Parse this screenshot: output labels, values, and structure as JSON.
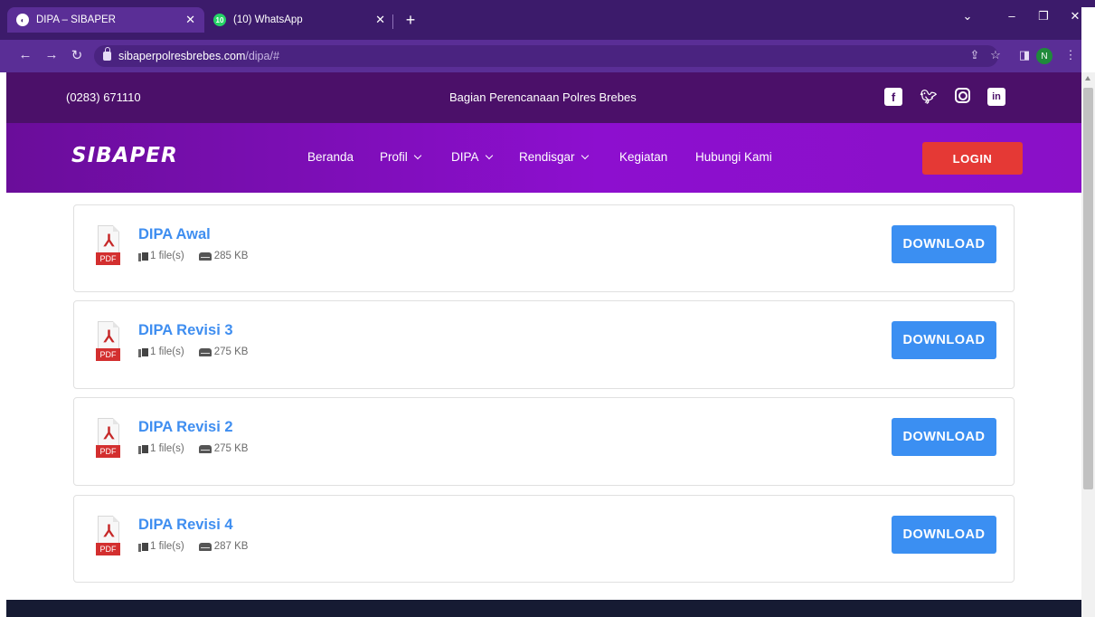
{
  "browser": {
    "tabs": [
      {
        "title": "DIPA – SIBAPER",
        "active": true
      },
      {
        "title": "(10) WhatsApp",
        "badge": "10",
        "active": false
      }
    ],
    "url_host": "sibaperpolresbrebes.com",
    "url_path": "/dipa/#",
    "profile_initial": "N"
  },
  "topbar": {
    "phone": "(0283) 671110",
    "tagline": "Bagian Perencanaan Polres Brebes",
    "social": [
      "facebook-icon",
      "twitter-icon",
      "instagram-icon",
      "linkedin-icon"
    ]
  },
  "navbar": {
    "brand": "SIBAPER",
    "menu": [
      {
        "label": "Beranda",
        "dropdown": false
      },
      {
        "label": "Profil",
        "dropdown": true
      },
      {
        "label": "DIPA",
        "dropdown": true
      },
      {
        "label": "Rendisgar",
        "dropdown": true
      },
      {
        "label": "Kegiatan",
        "dropdown": false
      },
      {
        "label": "Hubungi Kami",
        "dropdown": false
      }
    ],
    "login": "LOGIN"
  },
  "documents": [
    {
      "title": "DIPA Awal",
      "files": "1 file(s)",
      "size": "285 KB",
      "badge": "PDF",
      "button": "DOWNLOAD"
    },
    {
      "title": "DIPA Revisi 3",
      "files": "1 file(s)",
      "size": "275 KB",
      "badge": "PDF",
      "button": "DOWNLOAD"
    },
    {
      "title": "DIPA Revisi 2",
      "files": "1 file(s)",
      "size": "275 KB",
      "badge": "PDF",
      "button": "DOWNLOAD"
    },
    {
      "title": "DIPA Revisi 4",
      "files": "1 file(s)",
      "size": "287 KB",
      "badge": "PDF",
      "button": "DOWNLOAD"
    }
  ],
  "colors": {
    "topbar": "#4b1069",
    "navbar": "#8d0fcf",
    "login": "#e53935",
    "download": "#3b8ff2",
    "title_link": "#3f8ef0",
    "footer": "#161b33"
  }
}
